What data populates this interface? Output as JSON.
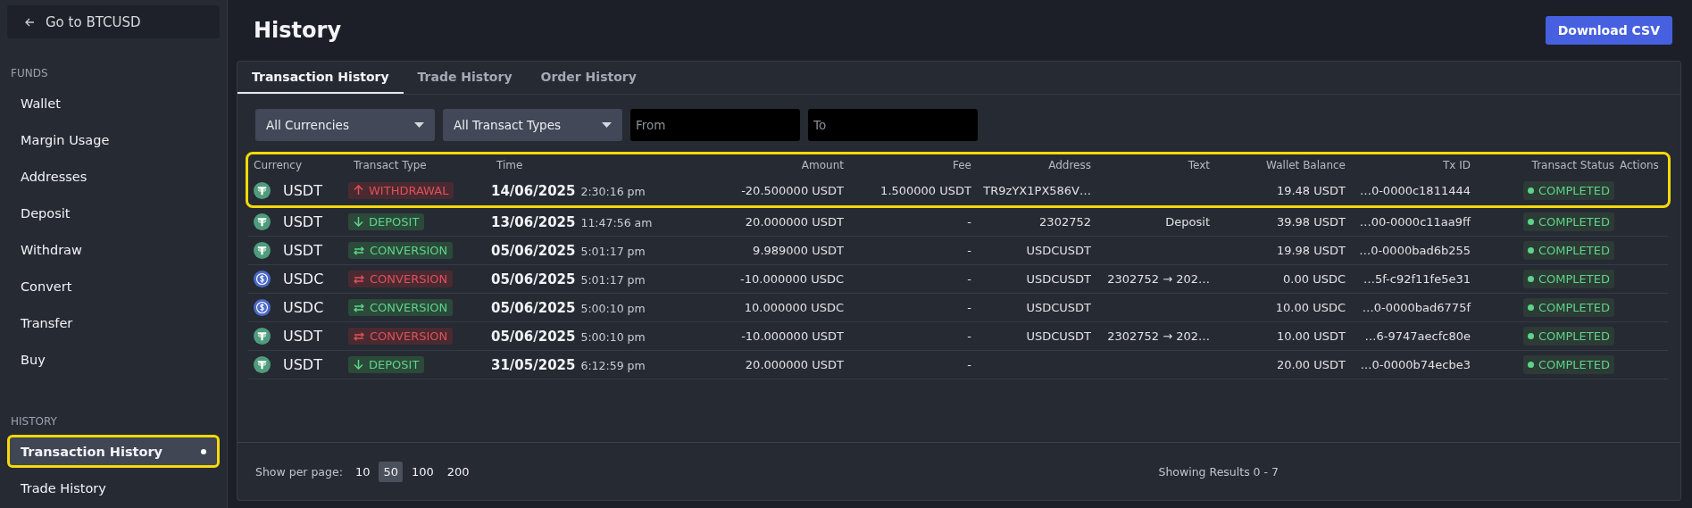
{
  "back_link": {
    "label": "Go to BTCUSD"
  },
  "sidebar": {
    "sections": [
      {
        "heading": "FUNDS",
        "items": [
          {
            "label": "Wallet",
            "selected": false,
            "highlighted": false
          },
          {
            "label": "Margin Usage",
            "selected": false,
            "highlighted": false
          },
          {
            "label": "Addresses",
            "selected": false,
            "highlighted": false
          },
          {
            "label": "Deposit",
            "selected": false,
            "highlighted": false
          },
          {
            "label": "Withdraw",
            "selected": false,
            "highlighted": false
          },
          {
            "label": "Convert",
            "selected": false,
            "highlighted": false
          },
          {
            "label": "Transfer",
            "selected": false,
            "highlighted": false
          },
          {
            "label": "Buy",
            "selected": false,
            "highlighted": false
          }
        ]
      },
      {
        "heading": "HISTORY",
        "items": [
          {
            "label": "Transaction History",
            "selected": true,
            "highlighted": true
          },
          {
            "label": "Trade History",
            "selected": false,
            "highlighted": false
          }
        ]
      }
    ]
  },
  "page_title": "History",
  "download_button": "Download CSV",
  "tabs": [
    {
      "label": "Transaction History",
      "selected": true
    },
    {
      "label": "Trade History",
      "selected": false
    },
    {
      "label": "Order History",
      "selected": false
    }
  ],
  "filters": {
    "currency": "All Currencies",
    "type": "All Transact Types",
    "from_placeholder": "From",
    "to_placeholder": "To"
  },
  "table": {
    "highlight_first_row": true,
    "columns": [
      "Currency",
      "Transact Type",
      "Time",
      "Amount",
      "Fee",
      "Address",
      "Text",
      "Wallet Balance",
      "Tx ID",
      "Transact Status",
      "Actions"
    ],
    "rows": [
      {
        "kind": "tether",
        "currency": "USDT",
        "type": {
          "kind": "withdrawal",
          "outgoing": true,
          "label": "WITHDRAWAL"
        },
        "date": "14/06/2025",
        "clock": "2:30:16 pm",
        "amount": "-20.500000 USDT",
        "fee": "1.500000 USDT",
        "address": "TR9zYX1PX586V…",
        "text": "",
        "balance": "19.48 USDT",
        "txid": "…0-0000c1811444",
        "status": "COMPLETED"
      },
      {
        "kind": "tether",
        "currency": "USDT",
        "type": {
          "kind": "deposit",
          "outgoing": false,
          "label": "DEPOSIT"
        },
        "date": "13/06/2025",
        "clock": "11:47:56 am",
        "amount": "20.000000 USDT",
        "fee": "-",
        "address": "2302752",
        "text": "Deposit",
        "balance": "39.98 USDT",
        "txid": "…00-0000c11aa9ff",
        "status": "COMPLETED"
      },
      {
        "kind": "tether",
        "currency": "USDT",
        "type": {
          "kind": "conversion",
          "outgoing": false,
          "label": "CONVERSION"
        },
        "date": "05/06/2025",
        "clock": "5:01:17 pm",
        "amount": "9.989000 USDT",
        "fee": "-",
        "address": "USDCUSDT",
        "text": "",
        "balance": "19.98 USDT",
        "txid": "…0-0000bad6b255",
        "status": "COMPLETED"
      },
      {
        "kind": "usdc",
        "currency": "USDC",
        "type": {
          "kind": "conversion",
          "outgoing": true,
          "label": "CONVERSION"
        },
        "date": "05/06/2025",
        "clock": "5:01:17 pm",
        "amount": "-10.000000 USDC",
        "fee": "-",
        "address": "USDCUSDT",
        "text": "2302752 → 202…",
        "balance": "0.00 USDC",
        "txid": "…5f-c92f11fe5e31",
        "status": "COMPLETED"
      },
      {
        "kind": "usdc",
        "currency": "USDC",
        "type": {
          "kind": "conversion",
          "outgoing": false,
          "label": "CONVERSION"
        },
        "date": "05/06/2025",
        "clock": "5:00:10 pm",
        "amount": "10.000000 USDC",
        "fee": "-",
        "address": "USDCUSDT",
        "text": "",
        "balance": "10.00 USDC",
        "txid": "…0-0000bad6775f",
        "status": "COMPLETED"
      },
      {
        "kind": "tether",
        "currency": "USDT",
        "type": {
          "kind": "conversion",
          "outgoing": true,
          "label": "CONVERSION"
        },
        "date": "05/06/2025",
        "clock": "5:00:10 pm",
        "amount": "-10.000000 USDT",
        "fee": "-",
        "address": "USDCUSDT",
        "text": "2302752 → 202…",
        "balance": "10.00 USDT",
        "txid": "…6-9747aecfc80e",
        "status": "COMPLETED"
      },
      {
        "kind": "tether",
        "currency": "USDT",
        "type": {
          "kind": "deposit",
          "outgoing": false,
          "label": "DEPOSIT"
        },
        "date": "31/05/2025",
        "clock": "6:12:59 pm",
        "amount": "20.000000 USDT",
        "fee": "-",
        "address": "",
        "text": "",
        "balance": "20.00 USDT",
        "txid": "…0-0000b74ecbe3",
        "status": "COMPLETED"
      }
    ]
  },
  "footer": {
    "per_page_label": "Show per page:",
    "per_page_options": [
      {
        "label": "10",
        "selected": false
      },
      {
        "label": "50",
        "selected": true
      },
      {
        "label": "100",
        "selected": false
      },
      {
        "label": "200",
        "selected": false
      }
    ],
    "results": "Showing Results 0 - 7"
  }
}
